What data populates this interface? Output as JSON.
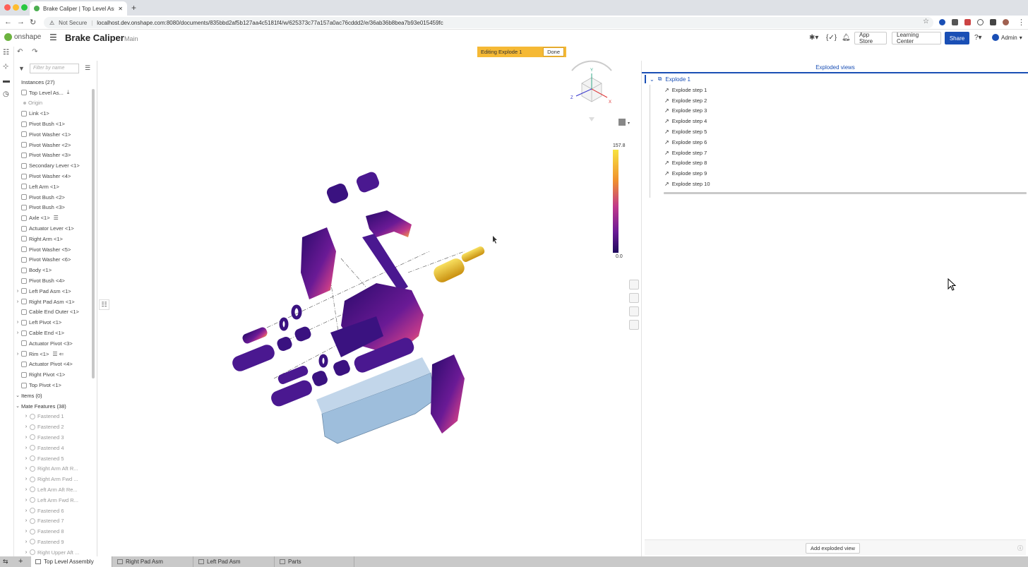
{
  "browser": {
    "tab_title": "Brake Caliper | Top Level Asse",
    "new_tab": "+",
    "security": "Not Secure",
    "url": "localhost.dev.onshape.com:8080/documents/835bbd2af5b127aa4c5181f4/w/625373c77a157a0ac76cddd2/e/36ab36b8bea7b93e015459fc"
  },
  "app": {
    "logo_text": "onshape",
    "document_title": "Brake Caliper",
    "branch": "Main",
    "app_store": "App Store",
    "learning_center": "Learning Center",
    "share": "Share",
    "user": "Admin"
  },
  "editing": {
    "label": "Editing Explode 1",
    "done": "Done"
  },
  "tree": {
    "filter_placeholder": "Filter by name",
    "rows": [
      {
        "label": "Instances (27)",
        "kind": "hdr"
      },
      {
        "label": "Top Level As...",
        "kind": "item",
        "toggle": "",
        "extra": "⤓"
      },
      {
        "label": "Origin",
        "kind": "muted"
      },
      {
        "label": "Link <1>",
        "kind": "item"
      },
      {
        "label": "Pivot Bush <1>",
        "kind": "item"
      },
      {
        "label": "Pivot Washer <1>",
        "kind": "item"
      },
      {
        "label": "Pivot Washer <2>",
        "kind": "item"
      },
      {
        "label": "Pivot Washer <3>",
        "kind": "item"
      },
      {
        "label": "Secondary Lever <1>",
        "kind": "item"
      },
      {
        "label": "Pivot Washer <4>",
        "kind": "item"
      },
      {
        "label": "Left Arm <1>",
        "kind": "item"
      },
      {
        "label": "Pivot Bush <2>",
        "kind": "item"
      },
      {
        "label": "Pivot Bush <3>",
        "kind": "item"
      },
      {
        "label": "Axle <1>",
        "kind": "item",
        "extra": "☰"
      },
      {
        "label": "Actuator Lever <1>",
        "kind": "item"
      },
      {
        "label": "Right Arm <1>",
        "kind": "item"
      },
      {
        "label": "Pivot Washer <5>",
        "kind": "item"
      },
      {
        "label": "Pivot Washer <6>",
        "kind": "item"
      },
      {
        "label": "Body <1>",
        "kind": "item"
      },
      {
        "label": "Pivot Bush <4>",
        "kind": "item"
      },
      {
        "label": "Left Pad Asm <1>",
        "kind": "item",
        "toggle": "›"
      },
      {
        "label": "Right Pad Asm <1>",
        "kind": "item",
        "toggle": "›"
      },
      {
        "label": "Cable End Outer <1>",
        "kind": "item"
      },
      {
        "label": "Left Pivot <1>",
        "kind": "item",
        "toggle": "›"
      },
      {
        "label": "Cable End <1>",
        "kind": "item",
        "toggle": "›"
      },
      {
        "label": "Actuator Pivot <3>",
        "kind": "item"
      },
      {
        "label": "Rim <1>",
        "kind": "item",
        "toggle": "›",
        "extra": "☰ ⇐"
      },
      {
        "label": "Actuator Pivot <4>",
        "kind": "item"
      },
      {
        "label": "Right Pivot <1>",
        "kind": "item"
      },
      {
        "label": "Top Pivot <1>",
        "kind": "item"
      },
      {
        "label": "Items (0)",
        "kind": "hdr",
        "toggle": "⌄"
      },
      {
        "label": "Mate Features (38)",
        "kind": "hdr",
        "toggle": "⌄"
      },
      {
        "label": "Fastened 1",
        "kind": "mate"
      },
      {
        "label": "Fastened 2",
        "kind": "mate"
      },
      {
        "label": "Fastened 3",
        "kind": "mate"
      },
      {
        "label": "Fastened 4",
        "kind": "mate"
      },
      {
        "label": "Fastened 5",
        "kind": "mate"
      },
      {
        "label": "Right Arm Aft R...",
        "kind": "mate"
      },
      {
        "label": "Right Arm Fwd ...",
        "kind": "mate"
      },
      {
        "label": "Left Arm Aft Re...",
        "kind": "mate"
      },
      {
        "label": "Left Arm Fwd R...",
        "kind": "mate"
      },
      {
        "label": "Fastened 6",
        "kind": "mate"
      },
      {
        "label": "Fastened 7",
        "kind": "mate"
      },
      {
        "label": "Fastened 8",
        "kind": "mate"
      },
      {
        "label": "Fastened 9",
        "kind": "mate"
      },
      {
        "label": "Right Upper Aft ...",
        "kind": "mate"
      }
    ]
  },
  "legend": {
    "max": "157.8",
    "min": "0.0"
  },
  "axes": {
    "x": "X",
    "y": "Y",
    "z": "Z"
  },
  "exploded": {
    "header": "Exploded views",
    "root": "Explode 1",
    "steps": [
      "Explode step 1",
      "Explode step 2",
      "Explode step 3",
      "Explode step 4",
      "Explode step 5",
      "Explode step 6",
      "Explode step 7",
      "Explode step 8",
      "Explode step 9",
      "Explode step 10"
    ],
    "add_button": "Add exploded view"
  },
  "bottom_tabs": [
    {
      "label": "Top Level Assembly",
      "active": true
    },
    {
      "label": "Right Pad Asm",
      "active": false
    },
    {
      "label": "Left Pad Asm",
      "active": false
    },
    {
      "label": "Parts",
      "active": false
    }
  ],
  "colors": {
    "accent": "#1a4fb5",
    "banner": "#f5b935",
    "heat_low": "#2a0a6b",
    "heat_mid": "#a02a8a",
    "heat_high": "#f5d020",
    "pad": "#9ebedc"
  }
}
